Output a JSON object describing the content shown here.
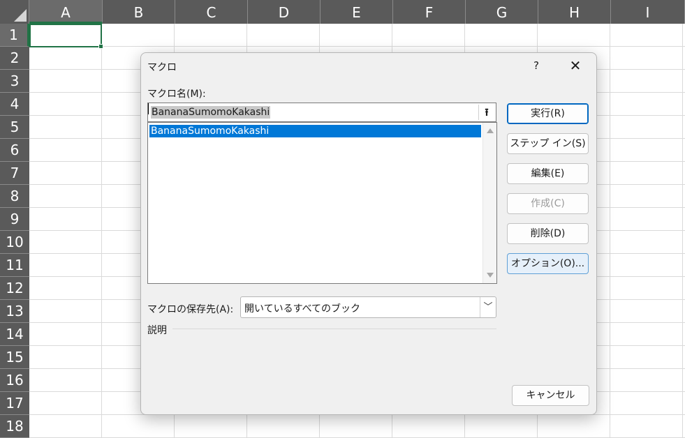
{
  "sheet": {
    "columns": [
      "A",
      "B",
      "C",
      "D",
      "E",
      "F",
      "G",
      "H",
      "I"
    ],
    "rows": [
      "1",
      "2",
      "3",
      "4",
      "5",
      "6",
      "7",
      "8",
      "9",
      "10",
      "11",
      "12",
      "13",
      "14",
      "15",
      "16",
      "17",
      "18"
    ],
    "selected_column": "A",
    "selected_row": "1",
    "accent_color": "#217346"
  },
  "dialog": {
    "title": "マクロ",
    "help": "?",
    "close": "✕",
    "macro_name_label": "マクロ名(M):",
    "macro_name_value": "BananaSumomoKakashi",
    "upload_icon": "⭱",
    "macro_list": [
      "BananaSumomoKakashi"
    ],
    "selected_index": 0,
    "buttons": {
      "run": "実行(R)",
      "step_in": "ステップ イン(S)",
      "edit": "編集(E)",
      "create": "作成(C)",
      "delete": "削除(D)",
      "options": "オプション(O)...",
      "cancel": "キャンセル"
    },
    "location_label": "マクロの保存先(A):",
    "location_value": "開いているすべてのブック",
    "description_label": "説明",
    "selection_color": "#0078d7"
  }
}
